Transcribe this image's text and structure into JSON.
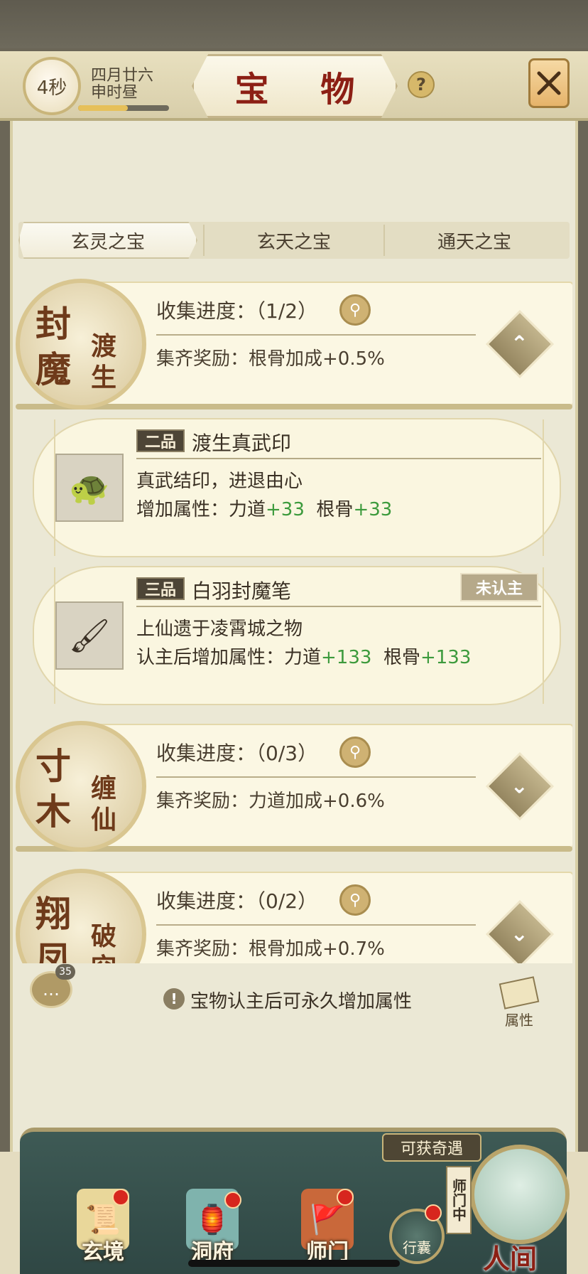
{
  "header": {
    "timer": "4秒",
    "date_line1": "四月廿六",
    "date_line2": "申时昼",
    "time_progress": 0.55,
    "title": "宝 物",
    "help_icon": "question-icon",
    "close_icon": "close-x-icon"
  },
  "tabs": [
    {
      "label": "玄灵之宝",
      "active": true
    },
    {
      "label": "玄天之宝",
      "active": false
    },
    {
      "label": "通天之宝",
      "active": false
    }
  ],
  "sets": [
    {
      "seal_big": [
        "封",
        "魔"
      ],
      "seal_small": [
        "渡",
        "生"
      ],
      "progress": "收集进度：（1/2）",
      "reward": "集齐奖励：根骨加成+0.5%",
      "expanded": true,
      "toggle_icon": "chevron-up-icon"
    },
    {
      "seal_big": [
        "寸",
        "木"
      ],
      "seal_small": [
        "缠",
        "仙"
      ],
      "progress": "收集进度：（0/3）",
      "reward": "集齐奖励：力道加成+0.6%",
      "expanded": false,
      "toggle_icon": "chevron-down-icon"
    },
    {
      "seal_big": [
        "翔",
        "凤"
      ],
      "seal_small": [
        "破",
        "空"
      ],
      "progress": "收集进度：（0/2）",
      "reward": "集齐奖励：根骨加成+0.7%",
      "expanded": false,
      "toggle_icon": "chevron-down-icon"
    }
  ],
  "items": [
    {
      "grade": "二品",
      "name": "渡生真武印",
      "desc": "真武结印，进退由心",
      "attr_prefix": "增加属性：力道",
      "attr_val1": "+33",
      "attr_mid": "根骨",
      "attr_val2": "+33",
      "icon": "jade-seal-icon",
      "unbound": ""
    },
    {
      "grade": "三品",
      "name": "白羽封魔笔",
      "desc": "上仙遗于凌霄城之物",
      "attr_prefix": "认主后增加属性：力道",
      "attr_val1": "+133",
      "attr_mid": "根骨",
      "attr_val2": "+133",
      "icon": "feather-brush-icon",
      "unbound": "未认主"
    }
  ],
  "tip": {
    "text": "宝物认主后可永久增加属性",
    "chat_count": "35",
    "attr_button": "属性"
  },
  "nav": {
    "items": [
      {
        "label": "玄境",
        "badge": true,
        "icon": "scroll-icon"
      },
      {
        "label": "洞府",
        "badge": true,
        "icon": "lantern-icon"
      },
      {
        "label": "师门",
        "badge": true,
        "icon": "banner-icon"
      }
    ],
    "bag_label": "行囊",
    "encounter_tag": "可获奇遇",
    "sect_tag": "师门中",
    "world_label": "人间"
  },
  "colors": {
    "attr_green": "#3c9a3c",
    "title_red": "#8c1f14",
    "badge_red": "#d7261e"
  }
}
